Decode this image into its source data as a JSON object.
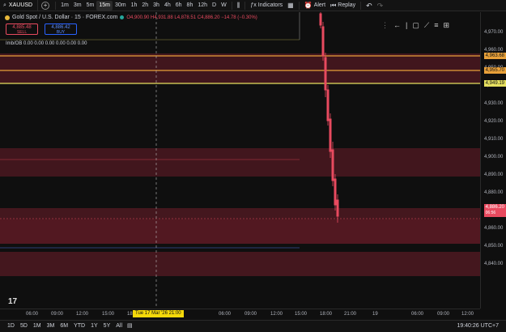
{
  "toolbar": {
    "symbol": "XAUUSD",
    "timeframes": [
      "1m",
      "3m",
      "5m",
      "15m",
      "30m",
      "1h",
      "2h",
      "3h",
      "4h",
      "6h",
      "8h",
      "12h",
      "D",
      "W"
    ],
    "active_timeframe": "15m",
    "indicators_label": "Indicators",
    "alert_label": "Alert",
    "replay_label": "Replay"
  },
  "legend": {
    "title": "Gold Spot / U.S. Dollar · 15 · FOREX.com",
    "ohlc": "O4,900.90 H4,931.88 L4,878.51 C4,886.20 −14.78 (−0.30%)",
    "sell_price": "4,885.48",
    "sell_label": "SELL",
    "buy_price": "4,886.42",
    "buy_label": "BUY",
    "imb": "Imb/OB  0.00  0.00  0.00  0.00  0.00  0.00"
  },
  "price_axis": {
    "ticks": [
      "4,970.00",
      "4,960.00",
      "4,950.00",
      "4,940.00",
      "4,930.00",
      "4,920.00",
      "4,910.00",
      "4,900.00",
      "4,890.00",
      "4,880.00",
      "4,870.00",
      "4,860.00",
      "4,850.00",
      "4,840.00"
    ],
    "level_labels": [
      {
        "text": "4,963.68",
        "color": "#e8a13a"
      },
      {
        "text": "4,955.70",
        "color": "#e8a13a"
      },
      {
        "text": "4,949.19",
        "color": "#e6e060"
      }
    ],
    "current_price": "4,886.20",
    "current_sub": "06:56"
  },
  "time_axis": {
    "ticks": [
      "06:00",
      "09:00",
      "12:00",
      "15:00",
      "18:00",
      "21:00",
      "06:00",
      "09:00",
      "12:00",
      "15:00",
      "18:00",
      "21:00",
      "19",
      "06:00",
      "09:00",
      "12:00"
    ],
    "crosshair_label": "Tue 17 Mar '26   21:00"
  },
  "range_bar": {
    "ranges": [
      "1D",
      "5D",
      "1M",
      "3M",
      "6M",
      "YTD",
      "1Y",
      "5Y",
      "All"
    ],
    "clock": "19:40:26 UTC+7"
  },
  "colors": {
    "zone": "#5a1a22",
    "candle_down": "#e84a5f",
    "level_orange": "#e8a13a",
    "level_yellow": "#e6e060",
    "crosshair": "#f5d90a"
  }
}
